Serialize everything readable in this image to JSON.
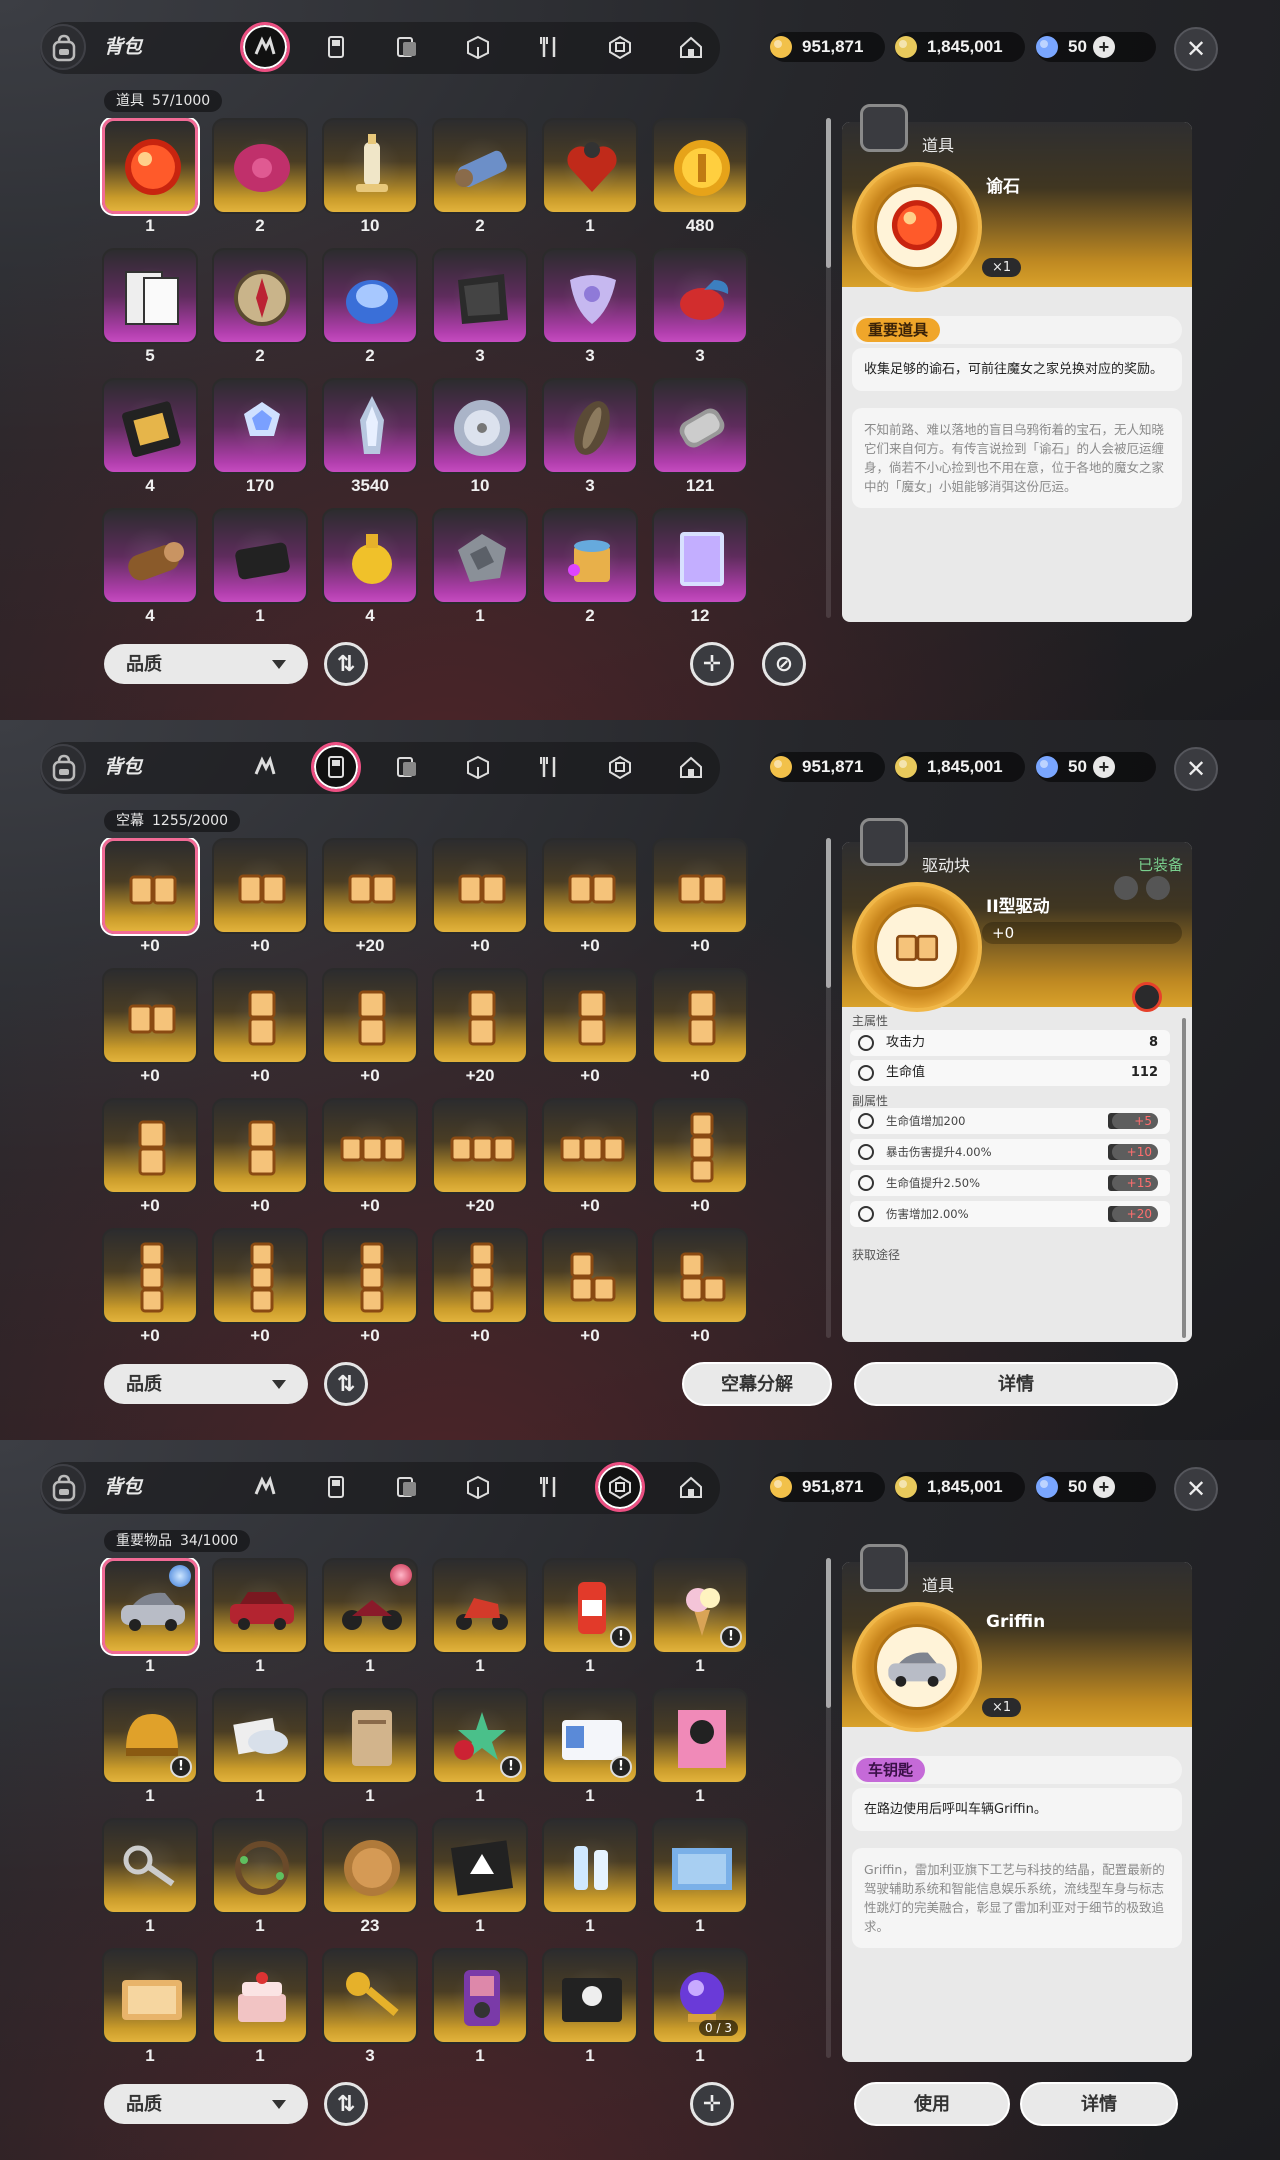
{
  "header": {
    "title": "背包",
    "currencies": [
      {
        "name": "coin",
        "value": "951,871",
        "color": "#f2c14a"
      },
      {
        "name": "ticket",
        "value": "1,845,001",
        "color": "#e8c95c"
      },
      {
        "name": "crystal",
        "value": "50",
        "color": "#7aa6ff",
        "has_plus": true
      }
    ],
    "tabs": [
      "items-tab",
      "drive-tab",
      "album-tab",
      "box-tab",
      "food-tab",
      "key-items-tab",
      "home-tab"
    ]
  },
  "panels": [
    {
      "active_tab": 0,
      "inventory_label": "道具",
      "inventory_count": "57/1000",
      "items": [
        {
          "icon": "red-orb",
          "count": "1",
          "rarity": "gold",
          "selected": true
        },
        {
          "icon": "pink-blob",
          "count": "2",
          "rarity": "gold"
        },
        {
          "icon": "chess-king",
          "count": "10",
          "rarity": "gold"
        },
        {
          "icon": "thread-spool",
          "count": "2",
          "rarity": "gold"
        },
        {
          "icon": "heart-lantern",
          "count": "1",
          "rarity": "gold"
        },
        {
          "icon": "gold-coin",
          "count": "480",
          "rarity": "gold"
        },
        {
          "icon": "newspaper",
          "count": "5",
          "rarity": "purple"
        },
        {
          "icon": "compass",
          "count": "2",
          "rarity": "purple"
        },
        {
          "icon": "ghost-potion",
          "count": "2",
          "rarity": "purple"
        },
        {
          "icon": "dark-cloth",
          "count": "3",
          "rarity": "purple"
        },
        {
          "icon": "guitar-pick",
          "count": "3",
          "rarity": "purple"
        },
        {
          "icon": "red-fish",
          "count": "3",
          "rarity": "purple"
        },
        {
          "icon": "circuit-board",
          "count": "4",
          "rarity": "purple"
        },
        {
          "icon": "crystal-cubes",
          "count": "170",
          "rarity": "purple"
        },
        {
          "icon": "crystal-tower",
          "count": "3540",
          "rarity": "purple"
        },
        {
          "icon": "silver-disc",
          "count": "10",
          "rarity": "purple"
        },
        {
          "icon": "seed",
          "count": "3",
          "rarity": "purple"
        },
        {
          "icon": "wire-coil",
          "count": "121",
          "rarity": "purple"
        },
        {
          "icon": "wood-log",
          "count": "4",
          "rarity": "purple"
        },
        {
          "icon": "dark-block",
          "count": "1",
          "rarity": "purple"
        },
        {
          "icon": "yellow-bottle",
          "count": "4",
          "rarity": "purple"
        },
        {
          "icon": "metal-scrap",
          "count": "1",
          "rarity": "purple"
        },
        {
          "icon": "paint-bucket",
          "count": "2",
          "rarity": "purple"
        },
        {
          "icon": "holo-card",
          "count": "12",
          "rarity": "purple"
        }
      ],
      "detail": {
        "category": "道具",
        "name": "谕石",
        "qty": "×1",
        "tag": "重要道具",
        "tag_color": "#f0a62a",
        "description": "收集足够的谕石，可前往魔女之家兑换对应的奖励。",
        "lore": "不知前路、难以落地的盲目乌鸦衔着的宝石，无人知晓它们来自何方。有传言说捡到「谕石」的人会被厄运缠身，倘若不小心捡到也不用在意，位于各地的魔女之家中的「魔女」小姐能够消弭这份厄运。"
      },
      "bottom": {
        "quality": "品质"
      }
    },
    {
      "active_tab": 1,
      "inventory_label": "空幕",
      "inventory_count": "1255/2000",
      "items": [
        {
          "icon": "drive-2h",
          "count": "+0",
          "selected": true
        },
        {
          "icon": "drive-2h",
          "count": "+0"
        },
        {
          "icon": "drive-2h",
          "count": "+20"
        },
        {
          "icon": "drive-2h",
          "count": "+0"
        },
        {
          "icon": "drive-2h",
          "count": "+0"
        },
        {
          "icon": "drive-2h",
          "count": "+0"
        },
        {
          "icon": "drive-2h",
          "count": "+0"
        },
        {
          "icon": "drive-2v",
          "count": "+0"
        },
        {
          "icon": "drive-2v",
          "count": "+0"
        },
        {
          "icon": "drive-2v",
          "count": "+20"
        },
        {
          "icon": "drive-2v",
          "count": "+0"
        },
        {
          "icon": "drive-2v",
          "count": "+0"
        },
        {
          "icon": "drive-2v",
          "count": "+0"
        },
        {
          "icon": "drive-2v",
          "count": "+0"
        },
        {
          "icon": "drive-3h",
          "count": "+0"
        },
        {
          "icon": "drive-3h",
          "count": "+20"
        },
        {
          "icon": "drive-3h",
          "count": "+0"
        },
        {
          "icon": "drive-3v",
          "count": "+0"
        },
        {
          "icon": "drive-3v",
          "count": "+0"
        },
        {
          "icon": "drive-3v",
          "count": "+0"
        },
        {
          "icon": "drive-3v",
          "count": "+0"
        },
        {
          "icon": "drive-3v",
          "count": "+0"
        },
        {
          "icon": "drive-L",
          "count": "+0"
        },
        {
          "icon": "drive-L",
          "count": "+0"
        }
      ],
      "detail": {
        "category": "驱动块",
        "equipped": "已装备",
        "name": "II型驱动",
        "level": "+0",
        "main_attr_label": "主属性",
        "main_attrs": [
          {
            "icon": "attack-icon",
            "label": "攻击力",
            "value": "8"
          },
          {
            "icon": "hp-icon",
            "label": "生命值",
            "value": "112"
          }
        ],
        "sub_attr_label": "副属性",
        "sub_attrs": [
          {
            "icon": "hp-icon",
            "label": "生命值增加200",
            "bonus": "+5"
          },
          {
            "icon": "crit-icon",
            "label": "暴击伤害提升4.00%",
            "bonus": "+10"
          },
          {
            "icon": "hp-icon",
            "label": "生命值提升2.50%",
            "bonus": "+15"
          },
          {
            "icon": "damage-icon",
            "label": "伤害增加2.00%",
            "bonus": "+20"
          }
        ],
        "source_label": "获取途径"
      },
      "bottom": {
        "quality": "品质",
        "decompose": "空幕分解",
        "details": "详情"
      }
    },
    {
      "active_tab": 5,
      "inventory_label": "重要物品",
      "inventory_count": "34/1000",
      "items": [
        {
          "icon": "silver-car",
          "count": "1",
          "selected": true,
          "corner": "blue-badge"
        },
        {
          "icon": "red-car",
          "count": "1"
        },
        {
          "icon": "motorcycle",
          "count": "1",
          "corner": "red-badge"
        },
        {
          "icon": "red-scooter",
          "count": "1"
        },
        {
          "icon": "drink-can",
          "count": "1",
          "sub": "!"
        },
        {
          "icon": "ice-cream",
          "count": "1",
          "sub": "!"
        },
        {
          "icon": "gold-helmet",
          "count": "1",
          "sub": "!"
        },
        {
          "icon": "cloud-photos",
          "count": "1"
        },
        {
          "icon": "notebook",
          "count": "1"
        },
        {
          "icon": "star-badge",
          "count": "1",
          "sub": "!"
        },
        {
          "icon": "id-card",
          "count": "1",
          "sub": "!"
        },
        {
          "icon": "poster",
          "count": "1"
        },
        {
          "icon": "key-ring",
          "count": "1"
        },
        {
          "icon": "vine-wreath",
          "count": "1"
        },
        {
          "icon": "bronze-coin",
          "count": "23"
        },
        {
          "icon": "glove-card",
          "count": "1"
        },
        {
          "icon": "water-bottles",
          "count": "1"
        },
        {
          "icon": "blueprint",
          "count": "1"
        },
        {
          "icon": "photo-card",
          "count": "1"
        },
        {
          "icon": "cake",
          "count": "1"
        },
        {
          "icon": "gold-key",
          "count": "3"
        },
        {
          "icon": "music-player",
          "count": "1"
        },
        {
          "icon": "skull-card",
          "count": "1"
        },
        {
          "icon": "crystal-ball",
          "count": "1",
          "frac": "0 / 3"
        }
      ],
      "detail": {
        "category": "道具",
        "name": "Griffin",
        "qty": "×1",
        "tag": "车钥匙",
        "tag_color": "#c56ad8",
        "description": "在路边使用后呼叫车辆Griffin。",
        "lore": "Griffin，雷加利亚旗下工艺与科技的结晶，配置最新的驾驶辅助系统和智能信息娱乐系统，流线型车身与标志性跳灯的完美融合，彰显了雷加利亚对于细节的极致追求。"
      },
      "bottom": {
        "quality": "品质",
        "use": "使用",
        "details": "详情"
      }
    }
  ]
}
